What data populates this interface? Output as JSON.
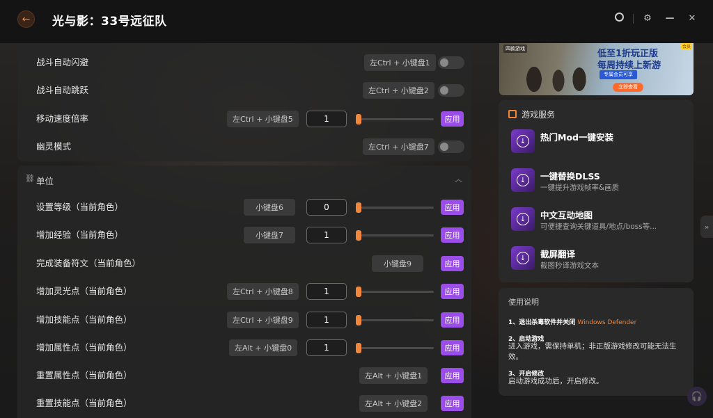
{
  "app": {
    "title": "光与影：33号远征队"
  },
  "icons": {
    "back": "back-arrow-icon",
    "avatar": "user-circle-icon",
    "settings": "settings-icon",
    "minimize": "minimize-icon",
    "close": "close-icon"
  },
  "card1": {
    "rows": [
      {
        "label": "战斗自动闪避",
        "hotkey": "左Ctrl + 小键盘1",
        "control": "toggle"
      },
      {
        "label": "战斗自动跳跃",
        "hotkey": "左Ctrl + 小键盘2",
        "control": "toggle"
      },
      {
        "label": "移动速度倍率",
        "hotkey": "左Ctrl + 小键盘5",
        "control": "slider",
        "value": "1",
        "apply": "应用"
      },
      {
        "label": "幽灵模式",
        "hotkey": "左Ctrl + 小键盘7",
        "control": "toggle"
      }
    ]
  },
  "units": {
    "title": "单位",
    "rows": [
      {
        "label": "设置等级（当前角色）",
        "hotkey": "小键盘6",
        "value": "0",
        "apply": "应用"
      },
      {
        "label": "增加经验（当前角色）",
        "hotkey": "小键盘7",
        "value": "1",
        "apply": "应用"
      },
      {
        "label": "完成装备符文（当前角色）",
        "hotkey": "小键盘9",
        "apply": "应用"
      },
      {
        "label": "增加灵光点（当前角色）",
        "hotkey": "左Ctrl + 小键盘8",
        "value": "1",
        "apply": "应用"
      },
      {
        "label": "增加技能点（当前角色）",
        "hotkey": "左Ctrl + 小键盘9",
        "value": "1",
        "apply": "应用"
      },
      {
        "label": "增加属性点（当前角色）",
        "hotkey": "左Alt + 小键盘0",
        "value": "1",
        "apply": "应用"
      },
      {
        "label": "重置属性点（当前角色）",
        "hotkey": "左Alt + 小键盘1",
        "apply": "应用"
      },
      {
        "label": "重置技能点（当前角色）",
        "hotkey": "左Alt + 小键盘2",
        "apply": "应用"
      }
    ]
  },
  "banner": {
    "brand": "四款游戏",
    "line1": "低至1折玩正版",
    "line2": "每周持续上新游",
    "vip": "专属会员可享",
    "cta": "立即查看",
    "tag": "会员"
  },
  "services": {
    "title": "游戏服务",
    "items": [
      {
        "title": "热门Mod一键安装",
        "desc": ""
      },
      {
        "title": "一键替换DLSS",
        "desc": "一键提升游戏帧率&画质"
      },
      {
        "title": "中文互动地图",
        "desc": "可便捷查询关键道具/地点/boss等..."
      },
      {
        "title": "截屏翻译",
        "desc": "截图秒译游戏文本"
      }
    ]
  },
  "usage": {
    "title": "使用说明",
    "step1": "1、退出杀毒软件并关闭",
    "step1_highlight": "Windows Defender",
    "step2": "2、启动游戏",
    "step2_text": "进入游戏，需保持单机；非正版游戏修改可能无法生效。",
    "step3": "3、开启修改",
    "step3_text": "启动游戏成功后，开启修改。"
  },
  "colors": {
    "accent": "#f0873a",
    "apply": "#9b4dea"
  }
}
